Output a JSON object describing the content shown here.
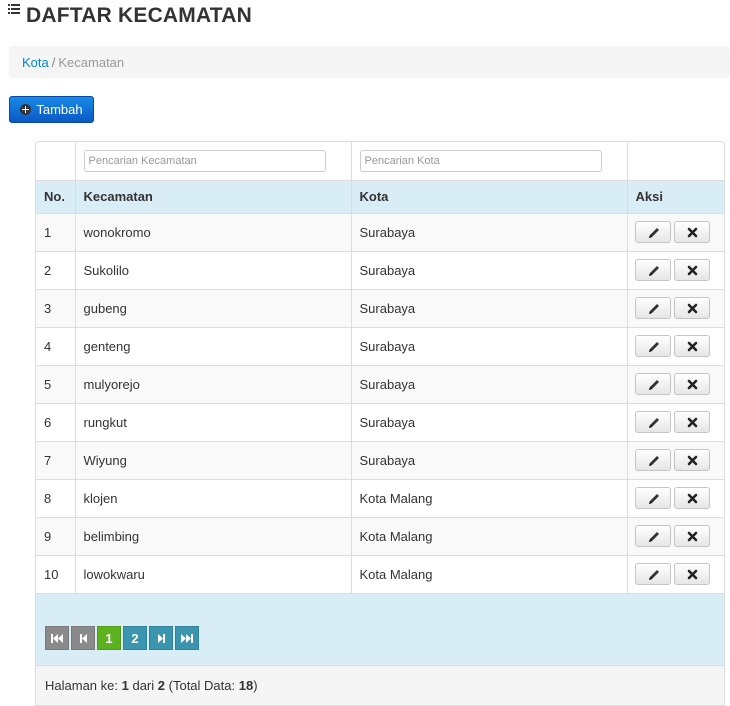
{
  "page": {
    "title": "DAFTAR KECAMATAN",
    "title_icon": "list-icon"
  },
  "breadcrumb": {
    "parent": "Kota",
    "separator": "/",
    "current": "Kecamatan"
  },
  "toolbar": {
    "add_label": "Tambah",
    "add_icon": "plus-circle-icon",
    "add_color": "#0a6ad6"
  },
  "filters": {
    "kecamatan_placeholder": "Pencarian Kecamatan",
    "kota_placeholder": "Pencarian Kota"
  },
  "table": {
    "columns": [
      "No.",
      "Kecamatan",
      "Kota",
      "Aksi"
    ],
    "rows": [
      {
        "no": "1",
        "kecamatan": "wonokromo",
        "kota": "Surabaya"
      },
      {
        "no": "2",
        "kecamatan": "Sukolilo",
        "kota": "Surabaya"
      },
      {
        "no": "3",
        "kecamatan": "gubeng",
        "kota": "Surabaya"
      },
      {
        "no": "4",
        "kecamatan": "genteng",
        "kota": "Surabaya"
      },
      {
        "no": "5",
        "kecamatan": "mulyorejo",
        "kota": "Surabaya"
      },
      {
        "no": "6",
        "kecamatan": "rungkut",
        "kota": "Surabaya"
      },
      {
        "no": "7",
        "kecamatan": "Wiyung",
        "kota": "Surabaya"
      },
      {
        "no": "8",
        "kecamatan": "klojen",
        "kota": "Kota Malang"
      },
      {
        "no": "9",
        "kecamatan": "belimbing",
        "kota": "Kota Malang"
      },
      {
        "no": "10",
        "kecamatan": "lowokwaru",
        "kota": "Kota Malang"
      }
    ],
    "row_actions": [
      "pencil-icon",
      "close-icon"
    ]
  },
  "pagination": {
    "buttons": [
      {
        "type": "first",
        "icon": "first-page-icon"
      },
      {
        "type": "prev",
        "icon": "prev-page-icon"
      },
      {
        "type": "page",
        "label": "1",
        "active": true
      },
      {
        "type": "page",
        "label": "2",
        "active": false
      },
      {
        "type": "next",
        "icon": "next-page-icon"
      },
      {
        "type": "last",
        "icon": "last-page-icon"
      }
    ],
    "info": {
      "label_page": "Halaman ke:",
      "current": "1",
      "label_of": "dari",
      "total_pages": "2",
      "label_total": "(Total Data:",
      "total_data": "18",
      "closing": ")"
    }
  },
  "colors": {
    "header_bg": "#d9edf7",
    "active_page": "#5bb11e",
    "page_btn": "#3a95ae",
    "nav_btn": "#8a8a8a",
    "link": "#0088cc"
  }
}
